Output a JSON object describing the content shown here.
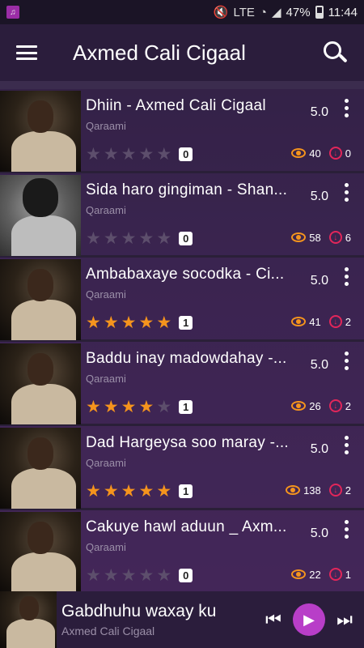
{
  "status": {
    "battery": "47%",
    "time": "11:44",
    "network": "LTE"
  },
  "appbar": {
    "title": "Axmed Cali Cigaal"
  },
  "songs": [
    {
      "title": "Dhiin - Axmed Cali Cigaal",
      "artist": "Qaraami",
      "rating": "5.0",
      "stars": 0,
      "votes": "0",
      "views": "40",
      "downloads": "0"
    },
    {
      "title": "Sida haro gingiman - Shan...",
      "artist": "Qaraami",
      "rating": "5.0",
      "stars": 0,
      "votes": "0",
      "views": "58",
      "downloads": "6"
    },
    {
      "title": "Ambabaxaye socodka - Ci...",
      "artist": "Qaraami",
      "rating": "5.0",
      "stars": 5,
      "votes": "1",
      "views": "41",
      "downloads": "2"
    },
    {
      "title": "Baddu inay madowdahay -...",
      "artist": "Qaraami",
      "rating": "5.0",
      "stars": 4,
      "votes": "1",
      "views": "26",
      "downloads": "2"
    },
    {
      "title": "Dad Hargeysa soo maray -...",
      "artist": "Qaraami",
      "rating": "5.0",
      "stars": 5,
      "votes": "1",
      "views": "138",
      "downloads": "2"
    },
    {
      "title": "Cakuye hawl aduun _ Axm...",
      "artist": "Qaraami",
      "rating": "5.0",
      "stars": 0,
      "votes": "0",
      "views": "22",
      "downloads": "1"
    }
  ],
  "player": {
    "title": "Gabdhuhu waxay ku",
    "artist": "Axmed Cali Cigaal"
  },
  "colors": {
    "accent": "#b83ec8",
    "star": "#f5941d",
    "download": "#e2265a"
  }
}
